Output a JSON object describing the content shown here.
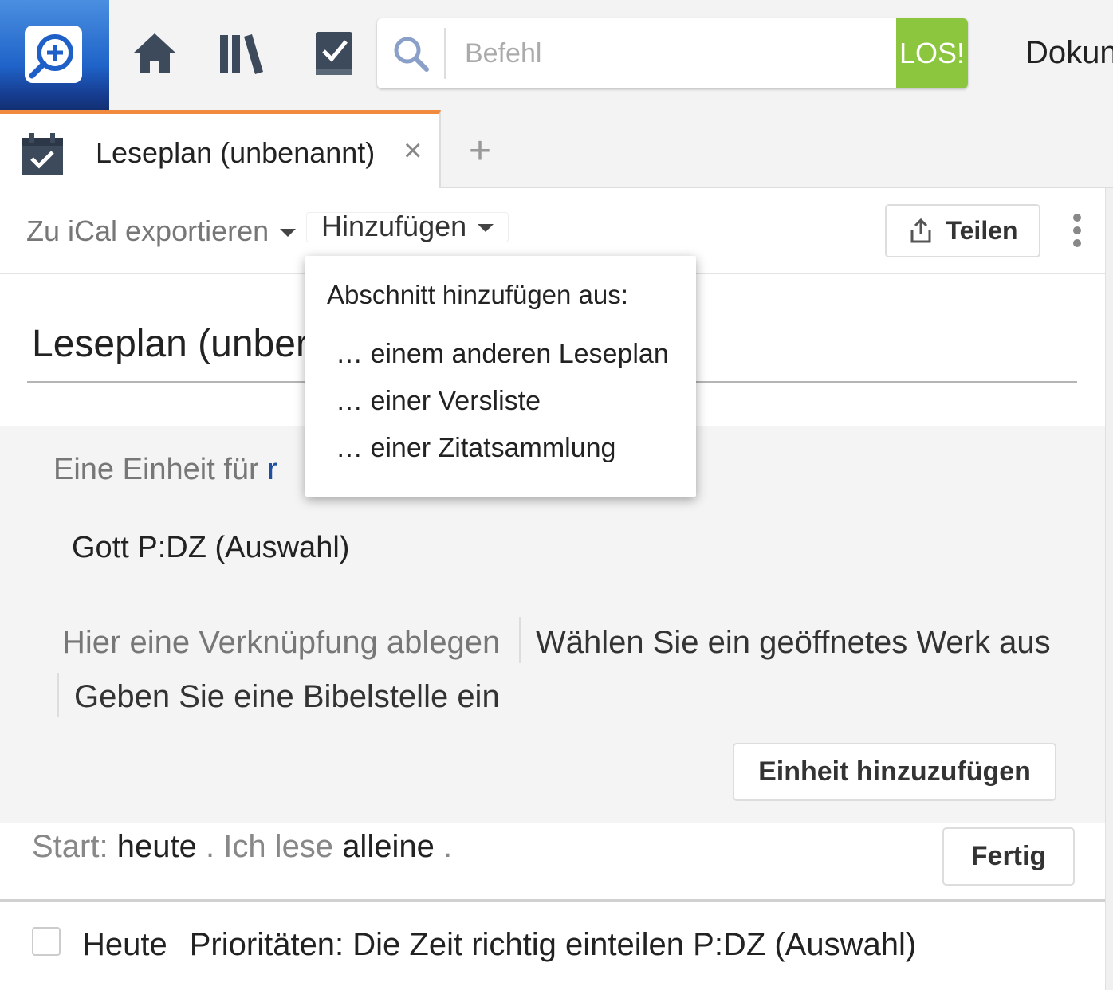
{
  "topbar": {
    "search": {
      "placeholder": "Befehl",
      "go_label": "LOS!"
    },
    "doc_label": "Dokun",
    "icons": [
      "logos-search-icon",
      "home-icon",
      "library-icon",
      "checklist-icon"
    ]
  },
  "tabs": [
    {
      "label": "Leseplan (unbenannt)",
      "icon": "calendar-check-icon",
      "close": "×"
    }
  ],
  "tab_add": "+",
  "toolbar": {
    "export_label": "Zu iCal exportieren",
    "add_label": "Hinzufügen",
    "share_label": "Teilen"
  },
  "dropdown": {
    "header": "Abschnitt hinzufügen aus:",
    "items": [
      "… einem anderen Leseplan",
      "… einer Versliste",
      "… einer Zitatsammlung"
    ]
  },
  "plan": {
    "title": "Leseplan (unber",
    "unit_prefix": "Eine Einheit für",
    "unit_link": "r",
    "source": "Gott P:DZ (Auswahl)",
    "drop_link": "Hier eine Verknüpfung ablegen",
    "choose_work": "Wählen Sie ein geöffnetes Werk aus",
    "enter_ref": "Geben Sie eine Bibelstelle ein",
    "add_unit_label": "Einheit hinzuzufügen"
  },
  "start": {
    "label": "Start:",
    "value": "heute",
    "sep": ".",
    "reading_label": "Ich lese",
    "reading_value": "alleine",
    "end": ".",
    "done_label": "Fertig"
  },
  "schedule": {
    "day": "Heute",
    "entry": "Prioritäten: Die Zeit richtig einteilen P:DZ (Auswahl)"
  },
  "colors": {
    "accent_orange": "#f08a3e",
    "go_green": "#8cc63f",
    "logo_blue": "#1f63c9",
    "link_blue": "#1f4fa0"
  }
}
